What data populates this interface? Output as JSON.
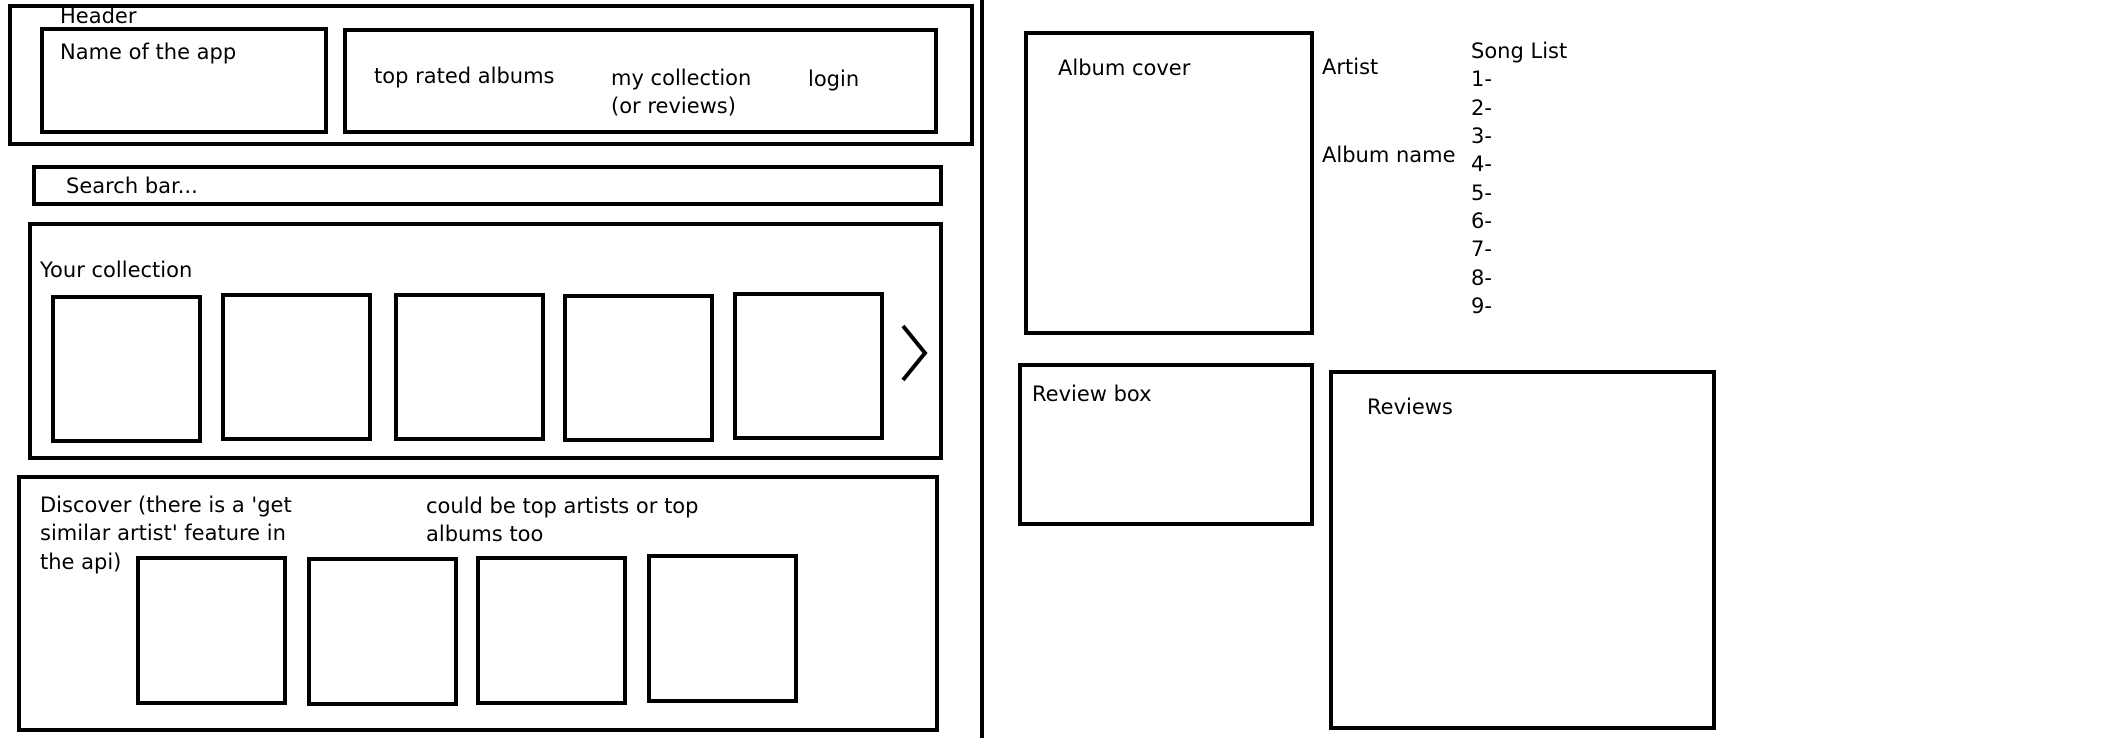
{
  "left_mockup": {
    "header": {
      "title": "Header",
      "app_name": "Name of the app",
      "nav": {
        "top_rated": "top rated albums",
        "my_collection_line1": "my collection",
        "my_collection_line2": "(or reviews)",
        "login": "login"
      }
    },
    "search": {
      "placeholder": "Search bar..."
    },
    "collection": {
      "title": "Your collection",
      "next_arrow_icon": "chevron-right-icon"
    },
    "discover": {
      "title_line1": "Discover (there is a 'get",
      "title_line2": "similar artist' feature in",
      "title_line3": "the api)",
      "note_line1": "could be top artists or top",
      "note_line2": "albums too"
    }
  },
  "right_mockup": {
    "album_cover": "Album cover",
    "artist": "Artist",
    "album_name": "Album name",
    "song_list": {
      "title": "Song List",
      "items": [
        "1-",
        "2-",
        "3-",
        "4-",
        "5-",
        "6-",
        "7-",
        "8-",
        "9-"
      ]
    },
    "review_box": "Review box",
    "reviews": "Reviews"
  }
}
